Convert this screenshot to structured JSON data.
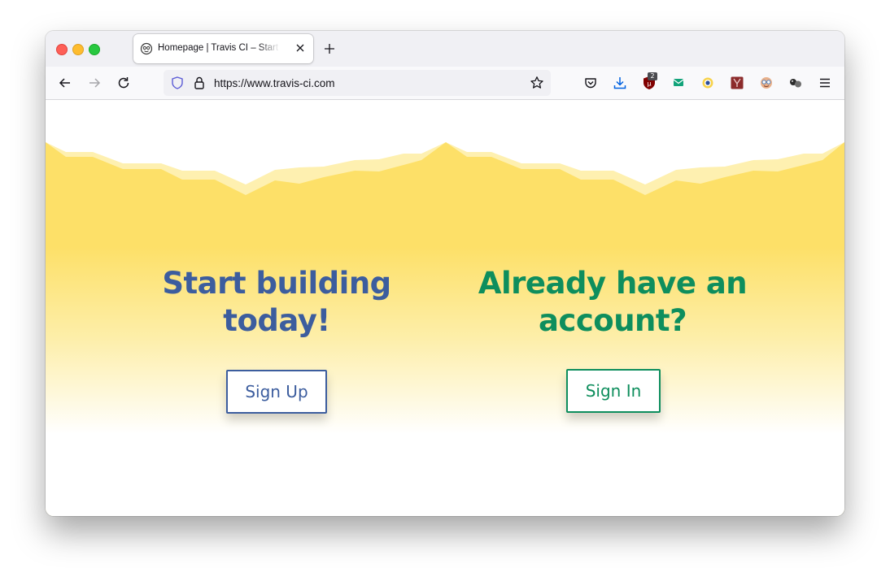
{
  "browser": {
    "tab_title": "Homepage | Travis CI – Start building",
    "url": "https://www.travis-ci.com",
    "extension_badge": "2"
  },
  "page": {
    "signup_heading": "Start building today!",
    "signup_button": "Sign Up",
    "signin_heading": "Already have an account?",
    "signin_button": "Sign In"
  },
  "colors": {
    "signup_accent": "#3c5d9e",
    "signin_accent": "#0e8e5d",
    "band_yellow": "#fde068"
  }
}
